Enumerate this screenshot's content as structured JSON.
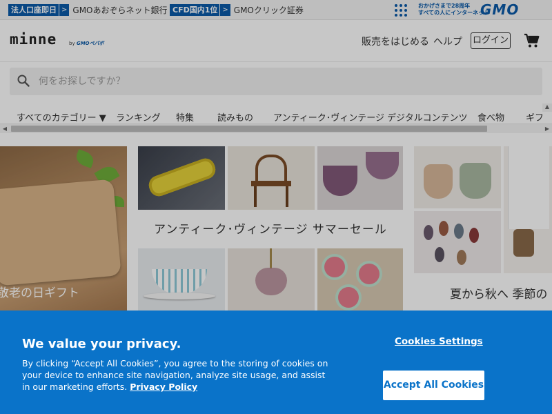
{
  "topbar": {
    "item1_badge": "法人口座即日",
    "item1_arrow": ">",
    "item1_text": "GMOあおぞらネット銀行",
    "item2_badge": "CFD国内1位",
    "item2_arrow": ">",
    "item2_text": "GMOクリック証券",
    "tagline_1": "おかげさまで28周年",
    "tagline_2": "すべての人にインターネット",
    "brand": "GMO"
  },
  "header": {
    "logo": "minne",
    "logo_by": "by",
    "logo_sub": "GMOペパボ",
    "sell_link": "販売をはじめる",
    "help_link": "ヘルプ",
    "login_button": "ログイン"
  },
  "search": {
    "placeholder": "何をお探しですか？"
  },
  "categories": [
    "すべてのカテゴリー ▼",
    "ランキング",
    "特集",
    "読みもの",
    "アンティーク･ヴィンテージ",
    "デジタルコンテンツ",
    "食べ物",
    "ギフ"
  ],
  "banners": {
    "left_caption": "敬老の日ギフト",
    "middle_caption": "アンティーク･ヴィンテージ サマーセール",
    "right_caption": "夏から秋へ 季節の"
  },
  "cookie": {
    "title": "We value your privacy.",
    "body": "By clicking “Accept All Cookies”, you agree to the storing of cookies on your device to enhance site navigation, analyze site usage, and assist in our marketing efforts.",
    "policy_link": "Privacy Policy",
    "settings_link": "Cookies Settings",
    "accept_button": "Accept All Cookies"
  },
  "colors": {
    "gmo_blue": "#0b5aa8",
    "cookie_blue": "#0a73c9"
  }
}
